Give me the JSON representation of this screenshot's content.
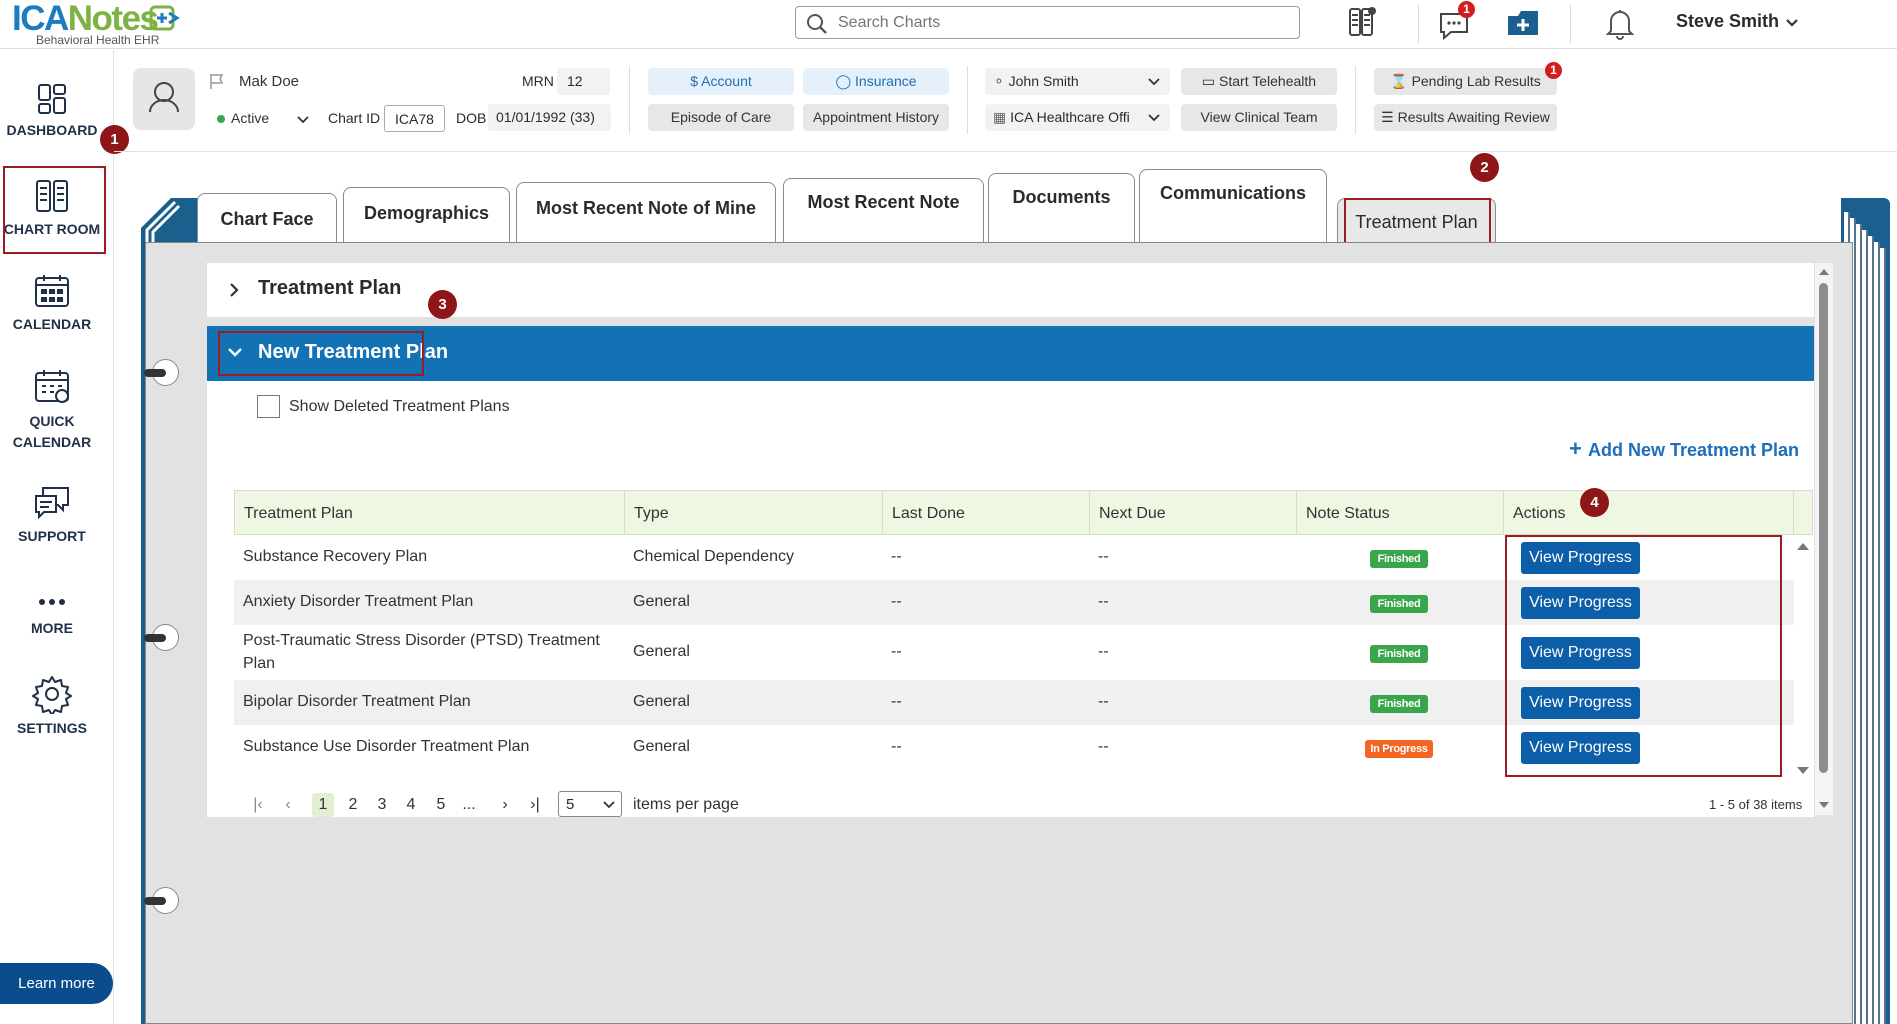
{
  "app": {
    "logo_ica": "ICA",
    "logo_notes": "Notes",
    "logo_sub": "Behavioral Health EHR",
    "search_placeholder": "Search Charts",
    "messages_badge": "1",
    "user_name": "Steve Smith"
  },
  "nav": {
    "items": [
      {
        "label": "DASHBOARD",
        "icon": "dashboard-icon"
      },
      {
        "label": "CHART ROOM",
        "icon": "chart-room-icon"
      },
      {
        "label": "CALENDAR",
        "icon": "calendar-icon"
      },
      {
        "label_line1": "QUICK",
        "label_line2": "CALENDAR",
        "icon": "quick-calendar-icon"
      },
      {
        "label": "SUPPORT",
        "icon": "support-icon"
      },
      {
        "label": "MORE",
        "icon": "more-icon"
      },
      {
        "label": "SETTINGS",
        "icon": "gear-icon"
      }
    ],
    "learn_more": "Learn more"
  },
  "patient": {
    "name": "Mak Doe",
    "status": "Active",
    "chart_id_label": "Chart ID",
    "chart_id": "ICA78",
    "mrn_label": "MRN",
    "mrn": "12",
    "dob_label": "DOB",
    "dob": "01/01/1992 (33)",
    "buttons": {
      "account": "Account",
      "insurance": "Insurance",
      "episode": "Episode of Care",
      "appointment_history": "Appointment History",
      "provider": "John Smith",
      "office": "ICA Healthcare Offi",
      "telehealth": "Start Telehealth",
      "clinical_team": "View Clinical Team",
      "pending_lab": "Pending Lab Results",
      "pending_lab_badge": "1",
      "results_review": "Results Awaiting Review"
    }
  },
  "tabs": [
    "Chart Face",
    "Demographics",
    "Most Recent Note of Mine",
    "Most Recent Note",
    "Documents",
    "Communications",
    "Treatment Plan"
  ],
  "steps": [
    "1",
    "2",
    "3",
    "4"
  ],
  "sections": {
    "treatment_plan": "Treatment Plan",
    "new_treatment_plan": "New Treatment Plan",
    "show_deleted": "Show Deleted Treatment Plans",
    "add_new": "Add New Treatment Plan"
  },
  "table": {
    "headers": [
      "Treatment Plan",
      "Type",
      "Last Done",
      "Next Due",
      "Note Status",
      "Actions"
    ],
    "rows": [
      {
        "plan": "Substance Recovery Plan",
        "plan2": "",
        "type": "Chemical Dependency",
        "last": "--",
        "next": "--",
        "status": "Finished",
        "action": "View Progress"
      },
      {
        "plan": "Anxiety Disorder Treatment Plan",
        "plan2": "",
        "type": "General",
        "last": "--",
        "next": "--",
        "status": "Finished",
        "action": "View Progress"
      },
      {
        "plan": "Post-Traumatic Stress Disorder (PTSD) Treatment",
        "plan2": "Plan",
        "type": "General",
        "last": "--",
        "next": "--",
        "status": "Finished",
        "action": "View Progress"
      },
      {
        "plan": "Bipolar Disorder Treatment Plan",
        "plan2": "",
        "type": "General",
        "last": "--",
        "next": "--",
        "status": "Finished",
        "action": "View Progress"
      },
      {
        "plan": "Substance Use Disorder Treatment Plan",
        "plan2": "",
        "type": "General",
        "last": "--",
        "next": "--",
        "status": "In Progress",
        "action": "View Progress"
      }
    ]
  },
  "pager": {
    "pages": [
      "1",
      "2",
      "3",
      "4",
      "5",
      "..."
    ],
    "per_page": "5",
    "per_page_label": "items per page",
    "summary": "1 - 5 of 38 items"
  },
  "colors": {
    "brand_blue": "#1b7dc1",
    "brand_green": "#7cb342",
    "section_blue": "#1272b3",
    "button_blue": "#0d5ea8",
    "status_finished": "#3aa64c",
    "status_in_progress": "#f26522",
    "highlight_red": "#9b1d22"
  }
}
